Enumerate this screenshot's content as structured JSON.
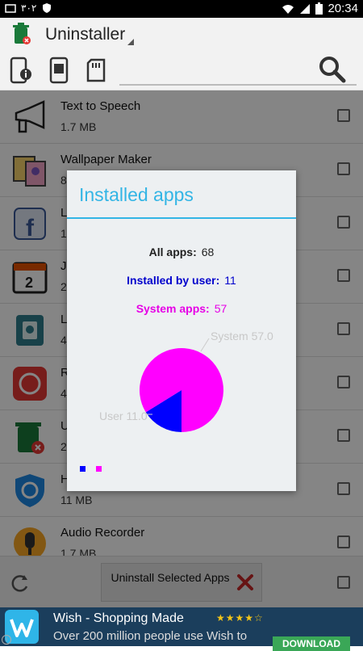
{
  "status_bar": {
    "time": "20:34",
    "left_icons": [
      "notification-icon",
      "arabic-text-icon",
      "shield-icon"
    ],
    "right_icons": [
      "wifi-icon",
      "signal-icon",
      "battery-icon"
    ]
  },
  "app_bar": {
    "title": "Uninstaller",
    "icon": "trash-can-icon"
  },
  "toolbar": {
    "icons": [
      "phone-info-icon",
      "phone-icon",
      "sd-card-icon",
      "search-icon"
    ]
  },
  "apps": [
    {
      "name": "Text to Speech",
      "size": "1.7 MB",
      "icon": "megaphone-icon"
    },
    {
      "name": "Wallpaper Maker",
      "size": "8",
      "icon": "photo-frames-icon"
    },
    {
      "name": "L",
      "size": "1",
      "icon": "facebook-icon"
    },
    {
      "name": "J",
      "size": "2",
      "icon": "calendar-icon"
    },
    {
      "name": "L",
      "size": "4",
      "icon": "lock-screen-icon"
    },
    {
      "name": "R",
      "size": "4",
      "icon": "record-icon"
    },
    {
      "name": "U",
      "size": "2",
      "icon": "trash-can-icon"
    },
    {
      "name": "H",
      "size": "11 MB",
      "icon": "vpn-shield-icon"
    },
    {
      "name": "Audio Recorder",
      "size": "1.7 MB",
      "icon": "microphone-icon"
    }
  ],
  "bottom_bar": {
    "uninstall_label": "Uninstall Selected Apps",
    "icon": "refresh-icon"
  },
  "ad": {
    "title": "Wish - Shopping Made",
    "subtitle": "Over 200 million people use Wish to",
    "rating_stars": "★★★★☆",
    "download": "DOWNLOAD",
    "info": "i"
  },
  "dialog": {
    "title": "Installed apps",
    "all_apps_label": "All apps:",
    "all_apps_value": "68",
    "user_label": "Installed by user:",
    "user_value": "11",
    "system_label": "System apps:",
    "system_value": "57"
  },
  "chart_data": {
    "type": "pie",
    "slices": [
      {
        "label": "User 11.0",
        "value": 11,
        "color": "#0000ff"
      },
      {
        "label": "System 57.0",
        "value": 57,
        "color": "#ff00ff"
      }
    ],
    "legend": [
      "#0000ff",
      "#ff00ff"
    ]
  },
  "colors": {
    "accent": "#33b5e5",
    "user": "#0000ff",
    "system": "#ff00ff"
  }
}
